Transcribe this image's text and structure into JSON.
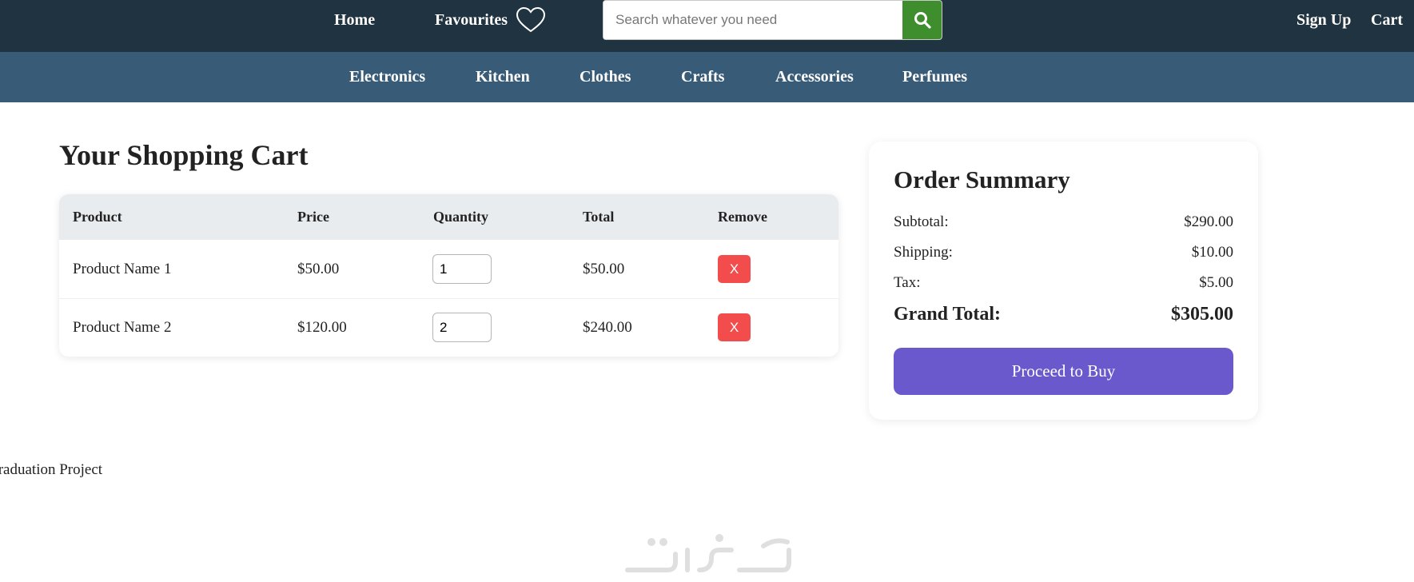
{
  "topnav": {
    "home": "Home",
    "favourites": "Favourites",
    "search_placeholder": "Search whatever you need",
    "sign_up": "Sign Up",
    "cart": "Cart"
  },
  "categories": [
    "Electronics",
    "Kitchen",
    "Clothes",
    "Crafts",
    "Accessories",
    "Perfumes"
  ],
  "cart": {
    "title": "Your Shopping Cart",
    "columns": [
      "Product",
      "Price",
      "Quantity",
      "Total",
      "Remove"
    ],
    "rows": [
      {
        "product": "Product Name 1",
        "price": "$50.00",
        "quantity": "1",
        "total": "$50.00",
        "remove_label": "X"
      },
      {
        "product": "Product Name 2",
        "price": "$120.00",
        "quantity": "2",
        "total": "$240.00",
        "remove_label": "X"
      }
    ]
  },
  "summary": {
    "title": "Order Summary",
    "subtotal_label": "Subtotal:",
    "subtotal_value": "$290.00",
    "shipping_label": "Shipping:",
    "shipping_value": "$10.00",
    "tax_label": "Tax:",
    "tax_value": "$5.00",
    "grand_label": "Grand Total:",
    "grand_value": "$305.00",
    "button_label": "Proceed to Buy"
  },
  "footer": {
    "text": "Graduation Project"
  },
  "colors": {
    "topbar": "#1f3340",
    "catbar": "#385c78",
    "search_button": "#3e8e2d",
    "remove_button": "#f24c4c",
    "buy_button": "#6a59cc"
  },
  "icons": [
    "heart-icon",
    "search-icon",
    "watermark-logo-icon"
  ]
}
